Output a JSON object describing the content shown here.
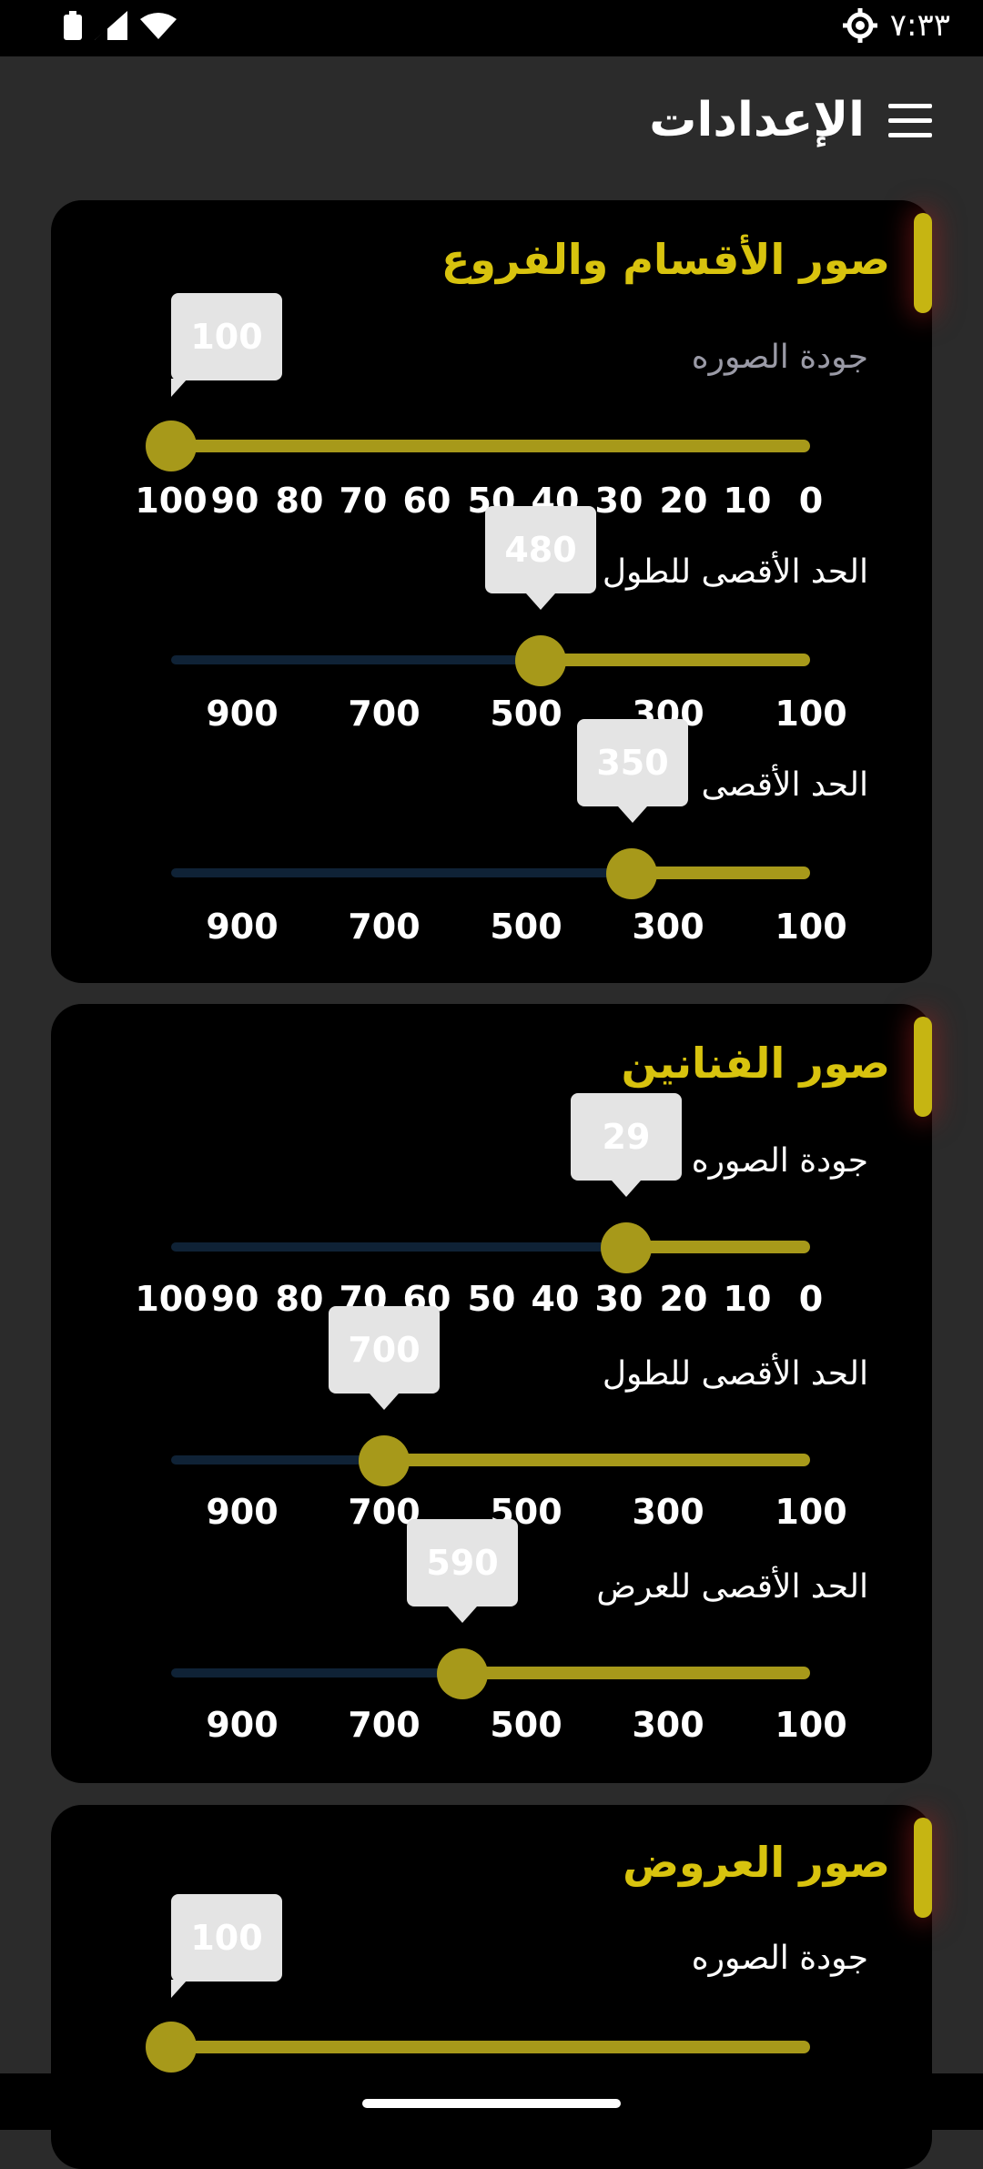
{
  "status_bar": {
    "time": "٧:٣٣",
    "icons": [
      "battery-icon",
      "signal-icon",
      "wifi-icon",
      "settings-gear-icon"
    ]
  },
  "app_bar": {
    "title": "الإعدادات",
    "menu_icon": "hamburger-menu-icon"
  },
  "sections": [
    {
      "title": "صور الأقسام والفروع",
      "sliders": [
        {
          "label": "جودة الصوره",
          "value": "100",
          "ticks": [
            "100",
            "90",
            "80",
            "70",
            "60",
            "50",
            "40",
            "30",
            "20",
            "10",
            "0"
          ]
        },
        {
          "label": "الحد الأقصى للطول",
          "value": "480",
          "ticks": [
            "900",
            "700",
            "500",
            "300",
            "100"
          ]
        },
        {
          "label": "الحد الأقصى",
          "value": "350",
          "ticks": [
            "900",
            "700",
            "500",
            "300",
            "100"
          ]
        }
      ]
    },
    {
      "title": "صور الفنانين",
      "sliders": [
        {
          "label": "جودة الصوره",
          "value": "29",
          "ticks": [
            "100",
            "90",
            "80",
            "70",
            "60",
            "50",
            "40",
            "30",
            "20",
            "10",
            "0"
          ]
        },
        {
          "label": "الحد الأقصى للطول",
          "value": "700",
          "ticks": [
            "900",
            "700",
            "500",
            "300",
            "100"
          ]
        },
        {
          "label": "الحد الأقصى للعرض",
          "value": "590",
          "ticks": [
            "900",
            "700",
            "500",
            "300",
            "100"
          ]
        }
      ]
    },
    {
      "title": "صور العروض",
      "sliders": [
        {
          "label": "جودة الصوره",
          "value": "100"
        }
      ]
    }
  ],
  "colors": {
    "accent": "#d8c30e",
    "track": "#a7991a",
    "inactive_track": "#0f2236",
    "card": "#000000",
    "background": "#2b2b2b"
  }
}
